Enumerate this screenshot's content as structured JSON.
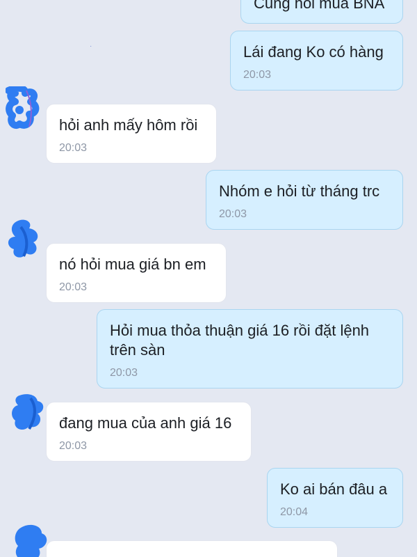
{
  "messages": [
    {
      "direction": "out",
      "text": "Cũng hỏi mua BNA",
      "time": ""
    },
    {
      "direction": "out",
      "text": "Lái đang Ko có hàng",
      "time": "20:03"
    },
    {
      "direction": "in",
      "text": "hỏi anh mấy hôm rồi",
      "time": "20:03"
    },
    {
      "direction": "out",
      "text": "Nhóm e hỏi từ tháng trc",
      "time": "20:03"
    },
    {
      "direction": "in",
      "text": "nó hỏi mua giá bn em",
      "time": "20:03"
    },
    {
      "direction": "out",
      "text": "Hỏi mua thỏa thuận giá 16 rồi đặt lệnh\ntrên sàn",
      "time": "20:03"
    },
    {
      "direction": "in",
      "text": "đang mua của anh giá 16",
      "time": "20:03"
    },
    {
      "direction": "out",
      "text": "Ko ai bán đâu a",
      "time": "20:04"
    },
    {
      "direction": "in",
      "text": "",
      "time": ""
    }
  ],
  "colors": {
    "background": "#e4e8f2",
    "outgoing_bubble": "#d6efff",
    "incoming_bubble": "#ffffff",
    "avatar_scribble": "#2f7df2",
    "timestamp": "#8e97a6"
  },
  "icons": {
    "avatar": "redacted-avatar-icon"
  }
}
